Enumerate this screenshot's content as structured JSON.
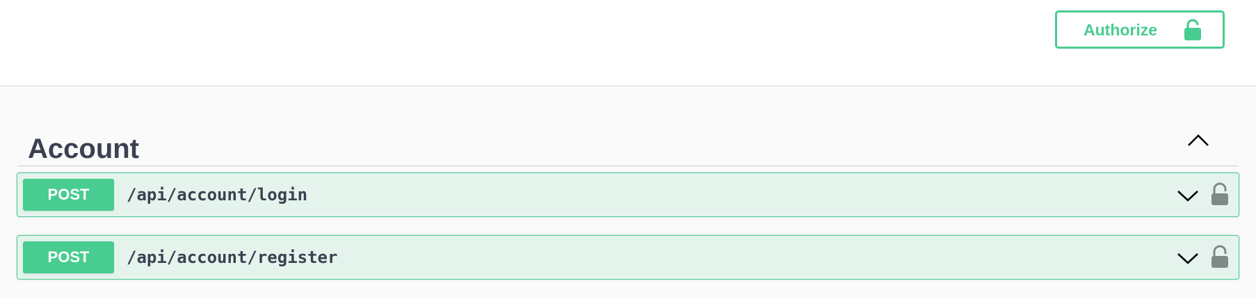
{
  "topbar": {
    "authorize_label": "Authorize",
    "accent_color": "#49cc90"
  },
  "tag": {
    "title": "Account",
    "expanded": true
  },
  "operations": [
    {
      "method": "POST",
      "path": "/api/account/login",
      "icon": "lock-icon"
    },
    {
      "method": "POST",
      "path": "/api/account/register",
      "icon": "lock-icon"
    }
  ],
  "colors": {
    "post": "#49cc90",
    "post_bg": "#e8f6f0",
    "text": "#3b4151",
    "lock_gray": "#7d8a87"
  }
}
